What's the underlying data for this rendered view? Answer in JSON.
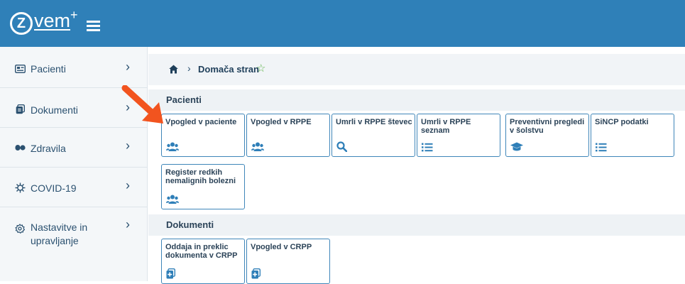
{
  "app": {
    "logo_text": "vem",
    "logo_letter": "Z",
    "logo_plus": "+"
  },
  "sidebar": {
    "items": [
      {
        "label": "Pacienti",
        "icon": "id-card-icon"
      },
      {
        "label": "Dokumenti",
        "icon": "document-icon"
      },
      {
        "label": "Zdravila",
        "icon": "pills-icon"
      },
      {
        "label": "COVID-19",
        "icon": "virus-icon"
      },
      {
        "label_line1": "Nastavitve in",
        "label_line2": "upravljanje",
        "icon": "gear-icon"
      }
    ]
  },
  "breadcrumb": {
    "current": "Domača stran"
  },
  "sections": {
    "pacienti": {
      "title": "Pacienti",
      "tiles": [
        {
          "title": "Vpogled v paciente",
          "icon": "users-icon"
        },
        {
          "title": "Vpogled v RPPE",
          "icon": "users-icon"
        },
        {
          "title": "Umrli v RPPE števec",
          "icon": "search-icon"
        },
        {
          "title": "Umrli v RPPE seznam",
          "icon": "list-icon"
        },
        {
          "title": "Preventivni pregledi v šolstvu",
          "icon": "graduation-cap-icon"
        },
        {
          "title": "SiNCP podatki",
          "icon": "list-icon"
        },
        {
          "title": "Register redkih nemalignih bolezni",
          "icon": "users-icon"
        }
      ]
    },
    "dokumenti": {
      "title": "Dokumenti",
      "tiles": [
        {
          "title": "Oddaja in preklic dokumenta v CRPP",
          "icon": "document-plus-icon"
        },
        {
          "title": "Vpogled v CRPP",
          "icon": "document-plus-icon"
        }
      ]
    }
  },
  "colors": {
    "topbar": "#2f80b8",
    "tile_border": "#3f86b9",
    "arrow": "#f2541f"
  }
}
